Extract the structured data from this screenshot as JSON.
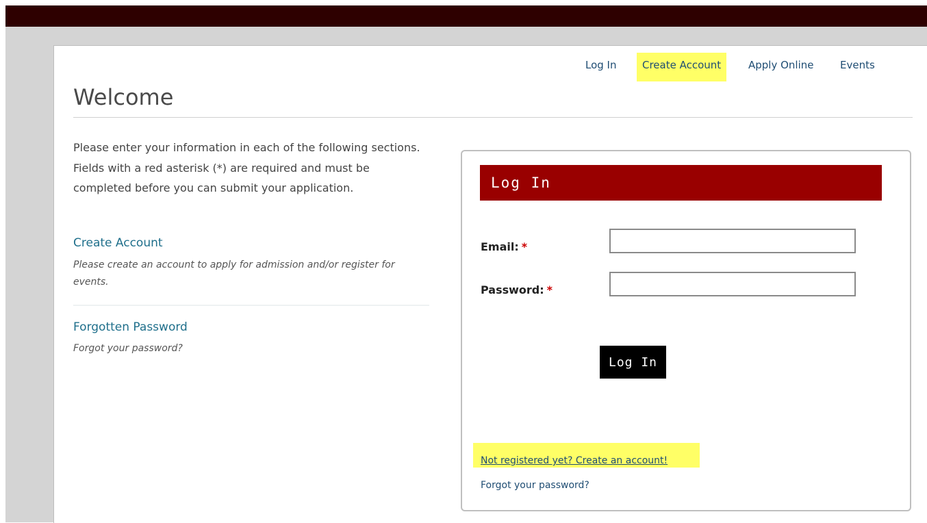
{
  "nav": {
    "login": "Log In",
    "create_account": "Create Account",
    "apply_online": "Apply Online",
    "events": "Events"
  },
  "page": {
    "title": "Welcome",
    "intro": "Please enter your information in each of the following sections. Fields with a red asterisk (*) are required and must be completed before you can submit your application."
  },
  "sidebar": {
    "create_account": {
      "label": "Create Account",
      "desc": "Please create an account to apply for admission and/or register for events."
    },
    "forgotten_password": {
      "label": "Forgotten Password",
      "desc": "Forgot your password?"
    }
  },
  "login_panel": {
    "header": "Log In",
    "email_label": "Email:",
    "password_label": "Password:",
    "required_marker": "*",
    "email_value": "",
    "password_value": "",
    "submit_label": "Log In",
    "register_link": "Not registered yet? Create an account!",
    "forgot_link": "Forgot your password?"
  },
  "colors": {
    "top_bar": "#2e0000",
    "header_red": "#990000",
    "highlight": "#ffff66",
    "link": "#1f6f8b"
  }
}
